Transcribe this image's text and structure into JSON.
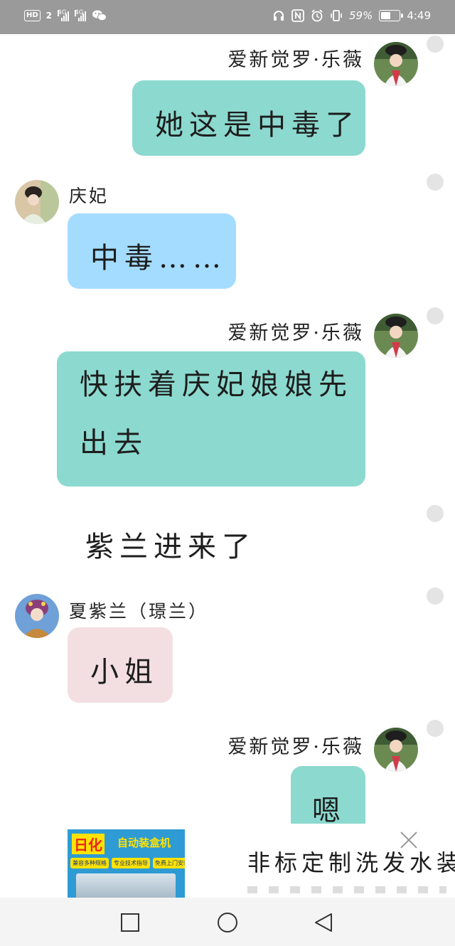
{
  "status_bar": {
    "hd": "HD",
    "sim1": "2",
    "net1": "4G",
    "net2": "4G",
    "battery_text": "59%",
    "battery_level": 0.59,
    "time": "4:49"
  },
  "messages": [
    {
      "speaker": "爱新觉罗·乐薇",
      "text": "她这是中毒了"
    },
    {
      "speaker": "庆妃",
      "text": "中毒……"
    },
    {
      "speaker": "爱新觉罗·乐薇",
      "text_line1": "快扶着庆妃娘娘先",
      "text_line2": "出去"
    },
    {
      "narration": "紫兰进来了"
    },
    {
      "speaker": "夏紫兰（璟兰）",
      "text": "小姐"
    },
    {
      "speaker": "爱新觉罗·乐薇",
      "text": "嗯"
    }
  ],
  "ad": {
    "brand": "日化",
    "product": "自动装盒机",
    "chips": [
      "兼容多种规格",
      "专业技术指导",
      "免费上门安装"
    ],
    "title": "非标定制洗发水装"
  },
  "icons": {
    "wifi": "wechat-icon",
    "headphones": "headphones-icon",
    "nfc": "nfc-icon",
    "alarm": "alarm-icon",
    "vibrate": "vibrate-icon",
    "close": "close-icon",
    "recents": "square-icon",
    "home": "circle-icon",
    "back": "triangle-back-icon"
  },
  "colors": {
    "self_bubble": "#8cd9cf",
    "qingfei_bubble": "#a4dcff",
    "zilan_bubble": "#f3dfe2"
  }
}
